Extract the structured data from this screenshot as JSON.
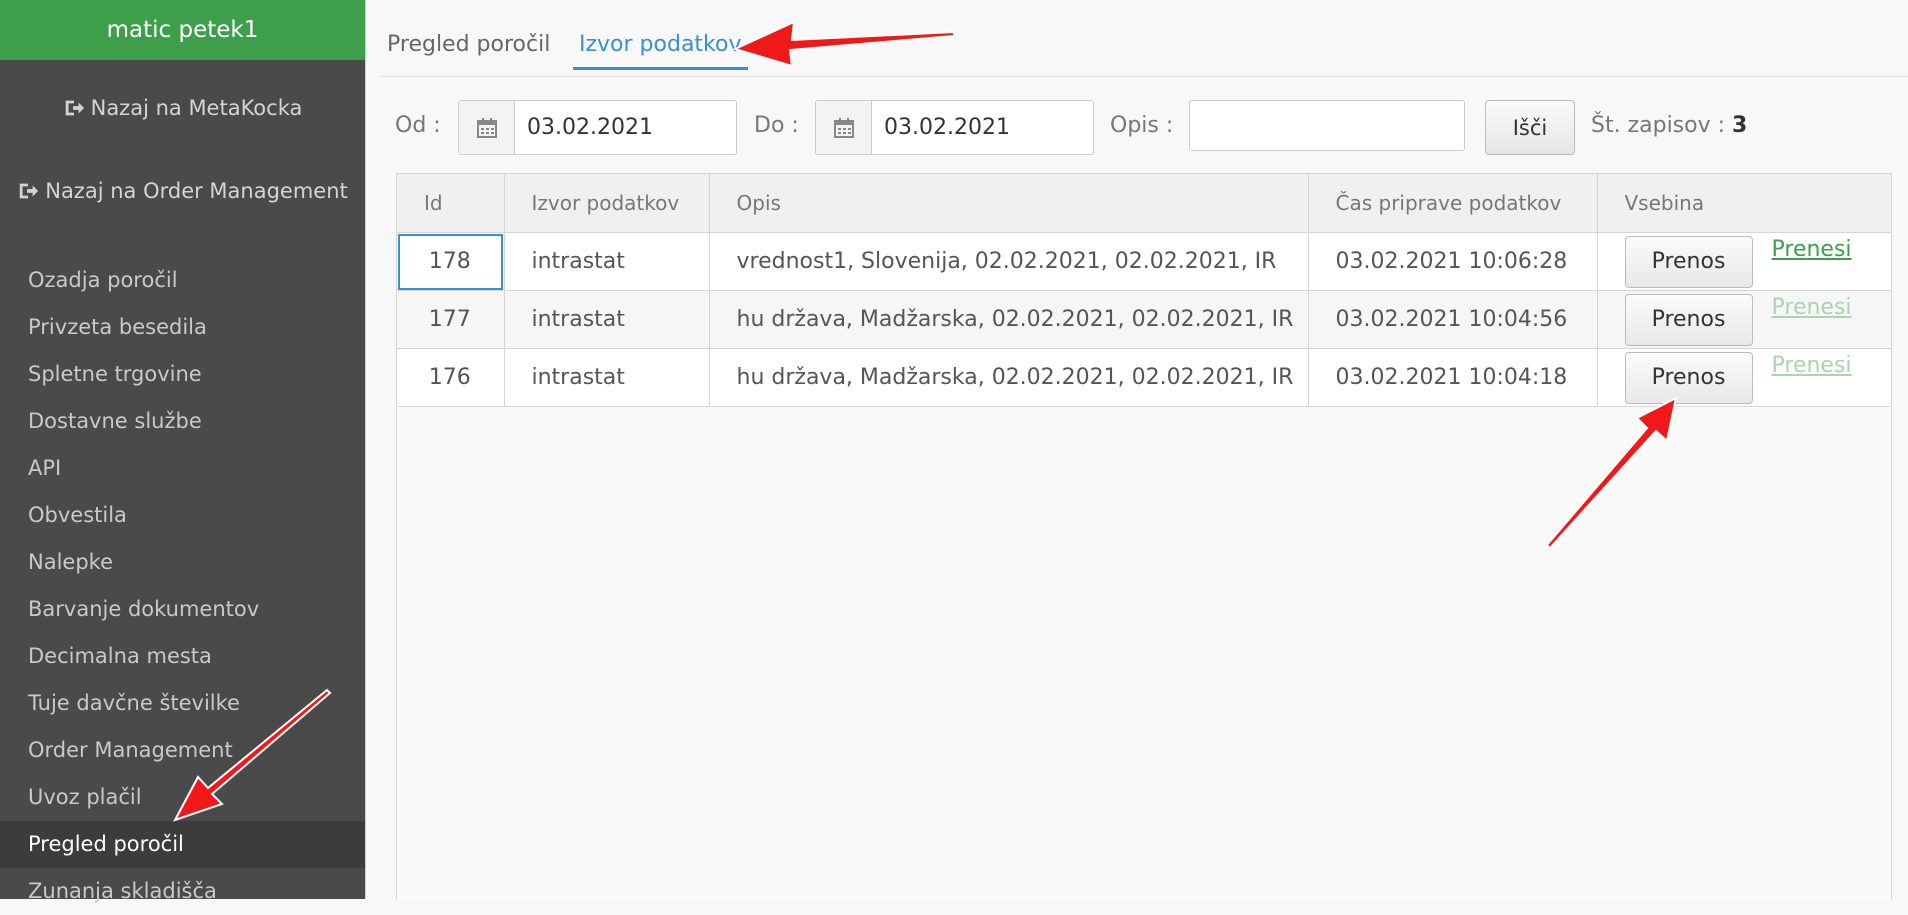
{
  "sidebar": {
    "user_name": "matic petek1",
    "back_metakocka": "Nazaj na MetaKocka",
    "back_order_management": "Nazaj na Order Management",
    "items": [
      {
        "label": "Ozadja poročil"
      },
      {
        "label": "Privzeta besedila"
      },
      {
        "label": "Spletne trgovine"
      },
      {
        "label": "Dostavne službe"
      },
      {
        "label": "API"
      },
      {
        "label": "Obvestila"
      },
      {
        "label": "Nalepke"
      },
      {
        "label": "Barvanje dokumentov"
      },
      {
        "label": "Decimalna mesta"
      },
      {
        "label": "Tuje davčne številke"
      },
      {
        "label": "Order Management"
      },
      {
        "label": "Uvoz plačil"
      },
      {
        "label": "Pregled poročil",
        "active": true
      },
      {
        "label": "Zunanja skladišča"
      }
    ]
  },
  "tabs": [
    {
      "label": "Pregled poročil",
      "active": false
    },
    {
      "label": "Izvor podatkov",
      "active": true
    }
  ],
  "filter": {
    "from_label": "Od :",
    "from_value": "03.02.2021",
    "to_label": "Do :",
    "to_value": "03.02.2021",
    "desc_label": "Opis :",
    "desc_value": "",
    "search_label": "Išči",
    "count_label": "Št. zapisov :",
    "count_value": "3"
  },
  "table": {
    "columns": [
      "Id",
      "Izvor podatkov",
      "Opis",
      "Čas priprave podatkov",
      "Vsebina"
    ],
    "rows": [
      {
        "id": "178",
        "source": "intrastat",
        "desc": "vrednost1, Slovenija, 02.02.2021, 02.02.2021, IR",
        "time": "03.02.2021 10:06:28",
        "button": "Prenos",
        "link": "Prenesi"
      },
      {
        "id": "177",
        "source": "intrastat",
        "desc": "hu država, Madžarska, 02.02.2021, 02.02.2021, IR",
        "time": "03.02.2021 10:04:56",
        "button": "Prenos",
        "link": "Prenesi"
      },
      {
        "id": "176",
        "source": "intrastat",
        "desc": "hu država, Madžarska, 02.02.2021, 02.02.2021, IR",
        "time": "03.02.2021 10:04:18",
        "button": "Prenos",
        "link": "Prenesi"
      }
    ]
  },
  "colors": {
    "user_bar": "#3e9f4b",
    "sidebar_bg": "#4a4a4a",
    "active_tab": "#3a8ed8",
    "annotation_arrow": "#f01818"
  }
}
